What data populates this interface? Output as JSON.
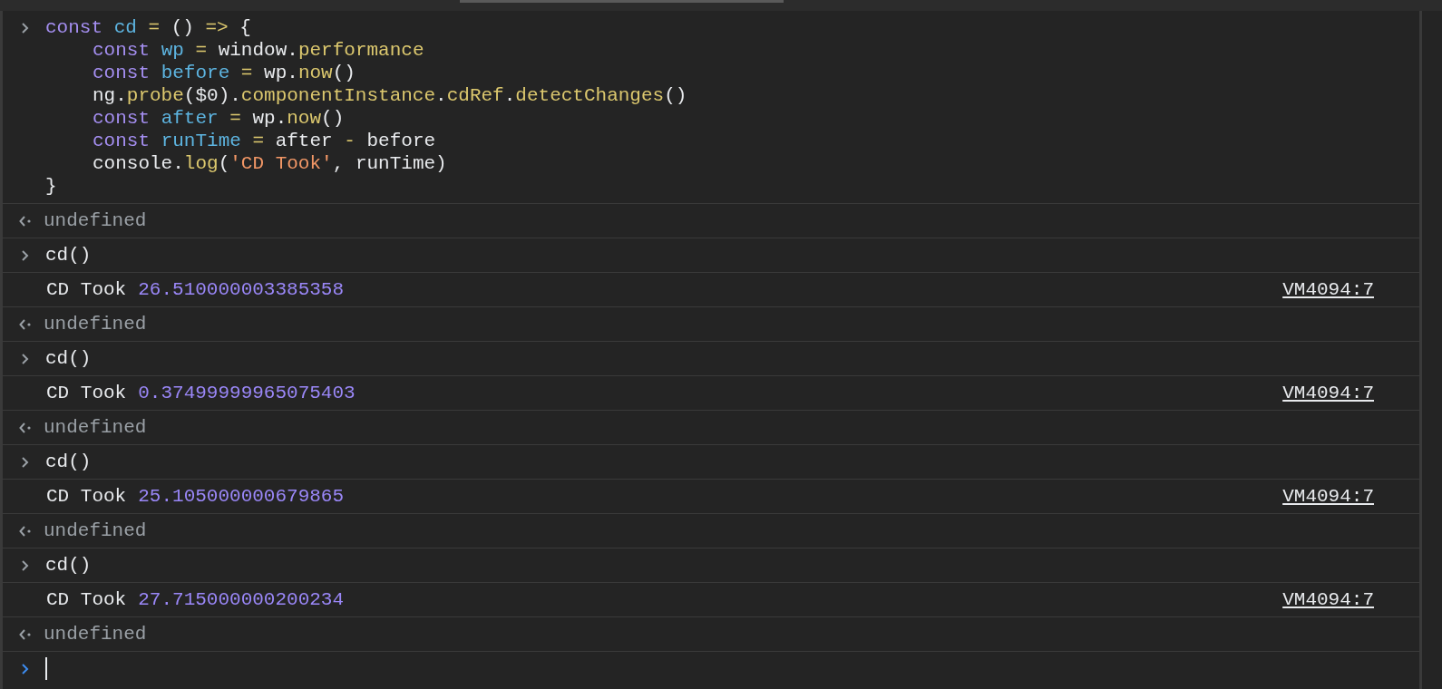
{
  "entries": [
    {
      "kind": "input",
      "lines": [
        {
          "indented": false,
          "tokens": [
            {
              "kind": "keyword",
              "text": "const "
            },
            {
              "kind": "variable",
              "text": "cd"
            },
            {
              "kind": "operator",
              "text": " = "
            },
            {
              "kind": "plain",
              "text": "() "
            },
            {
              "kind": "operator",
              "text": "=>"
            },
            {
              "kind": "plain",
              "text": " {"
            }
          ]
        },
        {
          "indented": true,
          "tokens": [
            {
              "kind": "keyword",
              "text": "const "
            },
            {
              "kind": "variable",
              "text": "wp"
            },
            {
              "kind": "operator",
              "text": " = "
            },
            {
              "kind": "plain",
              "text": "window."
            },
            {
              "kind": "function",
              "text": "performance"
            }
          ]
        },
        {
          "indented": true,
          "tokens": [
            {
              "kind": "keyword",
              "text": "const "
            },
            {
              "kind": "variable",
              "text": "before"
            },
            {
              "kind": "operator",
              "text": " = "
            },
            {
              "kind": "plain",
              "text": "wp."
            },
            {
              "kind": "function",
              "text": "now"
            },
            {
              "kind": "plain",
              "text": "()"
            }
          ]
        },
        {
          "indented": true,
          "tokens": [
            {
              "kind": "plain",
              "text": "ng."
            },
            {
              "kind": "function",
              "text": "probe"
            },
            {
              "kind": "plain",
              "text": "($0)."
            },
            {
              "kind": "function",
              "text": "componentInstance"
            },
            {
              "kind": "plain",
              "text": "."
            },
            {
              "kind": "function",
              "text": "cdRef"
            },
            {
              "kind": "plain",
              "text": "."
            },
            {
              "kind": "function",
              "text": "detectChanges"
            },
            {
              "kind": "plain",
              "text": "()"
            }
          ]
        },
        {
          "indented": true,
          "tokens": [
            {
              "kind": "keyword",
              "text": "const "
            },
            {
              "kind": "variable",
              "text": "after"
            },
            {
              "kind": "operator",
              "text": " = "
            },
            {
              "kind": "plain",
              "text": "wp."
            },
            {
              "kind": "function",
              "text": "now"
            },
            {
              "kind": "plain",
              "text": "()"
            }
          ]
        },
        {
          "indented": true,
          "tokens": [
            {
              "kind": "keyword",
              "text": "const "
            },
            {
              "kind": "variable",
              "text": "runTime"
            },
            {
              "kind": "operator",
              "text": " = "
            },
            {
              "kind": "plain",
              "text": "after "
            },
            {
              "kind": "operator",
              "text": "-"
            },
            {
              "kind": "plain",
              "text": " before"
            }
          ]
        },
        {
          "indented": true,
          "tokens": [
            {
              "kind": "plain",
              "text": "console."
            },
            {
              "kind": "function",
              "text": "log"
            },
            {
              "kind": "plain",
              "text": "("
            },
            {
              "kind": "string",
              "text": "'CD Took'"
            },
            {
              "kind": "plain",
              "text": ", runTime)"
            }
          ]
        },
        {
          "indented": false,
          "tokens": [
            {
              "kind": "plain",
              "text": "}"
            }
          ]
        }
      ]
    },
    {
      "kind": "result",
      "text": "undefined"
    },
    {
      "kind": "input",
      "lines": [
        {
          "indented": false,
          "tokens": [
            {
              "kind": "plain",
              "text": "cd()"
            }
          ]
        }
      ]
    },
    {
      "kind": "log",
      "message": "CD Took",
      "value": "26.510000003385358",
      "source": "VM4094:7"
    },
    {
      "kind": "result",
      "text": "undefined"
    },
    {
      "kind": "input",
      "lines": [
        {
          "indented": false,
          "tokens": [
            {
              "kind": "plain",
              "text": "cd()"
            }
          ]
        }
      ]
    },
    {
      "kind": "log",
      "message": "CD Took",
      "value": "0.37499999965075403",
      "source": "VM4094:7"
    },
    {
      "kind": "result",
      "text": "undefined"
    },
    {
      "kind": "input",
      "lines": [
        {
          "indented": false,
          "tokens": [
            {
              "kind": "plain",
              "text": "cd()"
            }
          ]
        }
      ]
    },
    {
      "kind": "log",
      "message": "CD Took",
      "value": "25.105000000679865",
      "source": "VM4094:7"
    },
    {
      "kind": "result",
      "text": "undefined"
    },
    {
      "kind": "input",
      "lines": [
        {
          "indented": false,
          "tokens": [
            {
              "kind": "plain",
              "text": "cd()"
            }
          ]
        }
      ]
    },
    {
      "kind": "log",
      "message": "CD Took",
      "value": "27.715000000200234",
      "source": "VM4094:7"
    },
    {
      "kind": "result",
      "text": "undefined"
    },
    {
      "kind": "prompt"
    }
  ]
}
